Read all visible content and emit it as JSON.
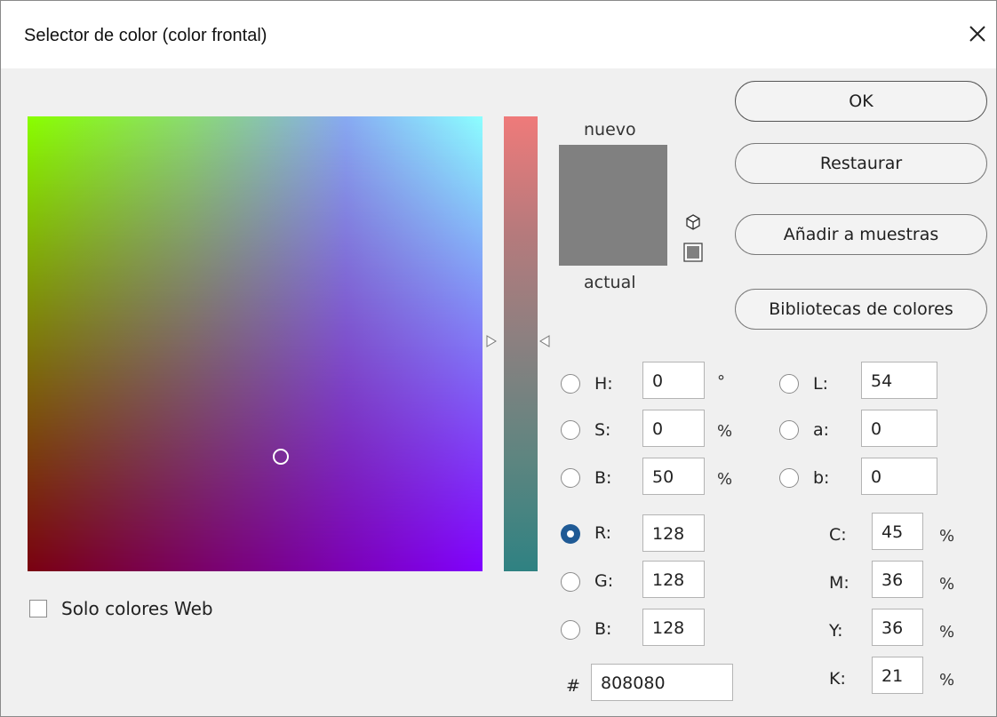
{
  "window": {
    "title": "Selector de color (color frontal)"
  },
  "swatch": {
    "new_label": "nuevo",
    "current_label": "actual",
    "new_color": "#808080",
    "current_color": "#808080"
  },
  "buttons": {
    "ok": "OK",
    "reset": "Restaurar",
    "add_swatch": "Añadir a muestras",
    "libraries": "Bibliotecas de colores"
  },
  "hsb": {
    "h": {
      "label": "H:",
      "value": "0",
      "unit": "°"
    },
    "s": {
      "label": "S:",
      "value": "0",
      "unit": "%"
    },
    "b": {
      "label": "B:",
      "value": "50",
      "unit": "%"
    }
  },
  "rgb": {
    "r": {
      "label": "R:",
      "value": "128"
    },
    "g": {
      "label": "G:",
      "value": "128"
    },
    "b": {
      "label": "B:",
      "value": "128"
    }
  },
  "lab": {
    "l": {
      "label": "L:",
      "value": "54"
    },
    "a": {
      "label": "a:",
      "value": "0"
    },
    "b": {
      "label": "b:",
      "value": "0"
    }
  },
  "cmyk": {
    "c": {
      "label": "C:",
      "value": "45",
      "unit": "%"
    },
    "m": {
      "label": "M:",
      "value": "36",
      "unit": "%"
    },
    "y": {
      "label": "Y:",
      "value": "36",
      "unit": "%"
    },
    "k": {
      "label": "K:",
      "value": "21",
      "unit": "%"
    }
  },
  "hex": {
    "label": "#",
    "value": "808080"
  },
  "web_only": {
    "label": "Solo colores Web",
    "checked": false
  },
  "icons": {
    "close": "close-icon",
    "gamut_warning": "cube-icon",
    "web_safe": "web-swatch-icon"
  }
}
